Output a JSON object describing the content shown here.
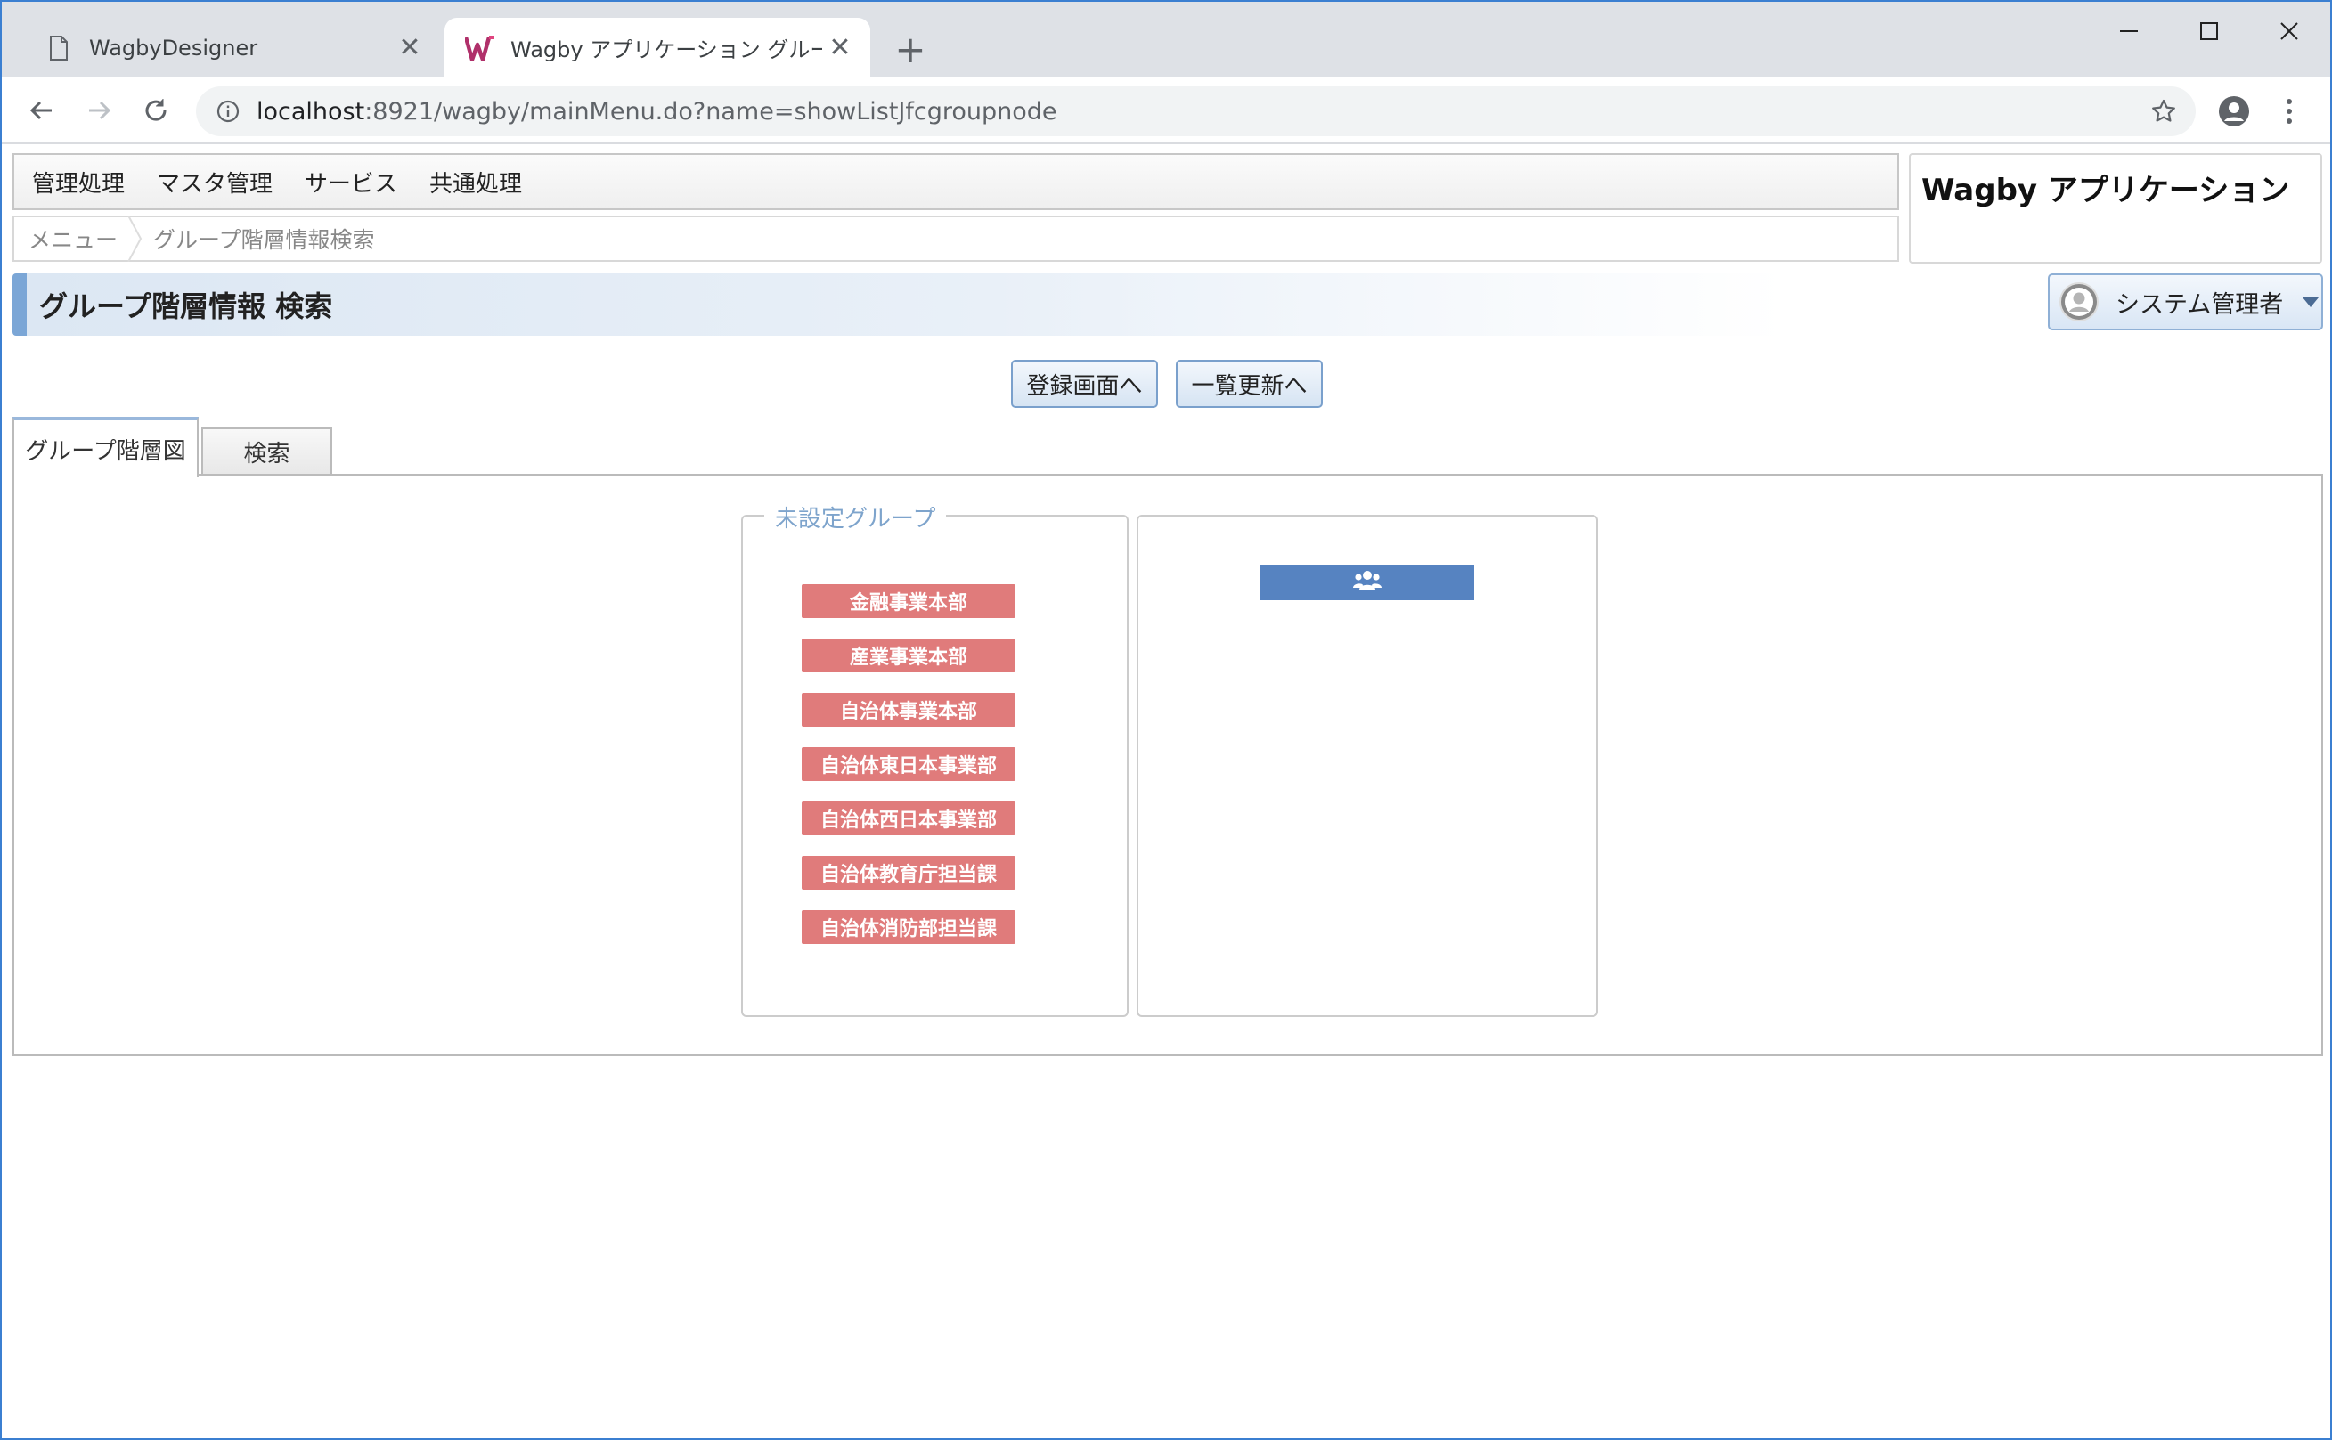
{
  "browser": {
    "tabs": [
      {
        "title": "WagbyDesigner"
      },
      {
        "title": "Wagby アプリケーション グループ階層"
      }
    ],
    "url_host": "localhost",
    "url_rest": ":8921/wagby/mainMenu.do?name=showListJfcgroupnode"
  },
  "app": {
    "menu": [
      "管理処理",
      "マスタ管理",
      "サービス",
      "共通処理"
    ],
    "breadcrumb": {
      "home": "メニュー",
      "current": "グループ階層情報検索"
    },
    "app_name": "Wagby アプリケーション",
    "page_title": "グループ階層情報 検索",
    "user_label": "システム管理者",
    "buttons": {
      "register": "登録画面へ",
      "list_update": "一覧更新へ"
    },
    "tabs": [
      "グループ階層図",
      "検索"
    ],
    "unassigned_group": {
      "legend": "未設定グループ",
      "items": [
        "金融事業本部",
        "産業事業本部",
        "自治体事業本部",
        "自治体東日本事業部",
        "自治体西日本事業部",
        "自治体教育庁担当課",
        "自治体消防部担当課"
      ]
    }
  },
  "colors": {
    "group_button": "#e07b7b",
    "group_bar": "#5683c1",
    "accent_border": "#7ba6d6"
  }
}
